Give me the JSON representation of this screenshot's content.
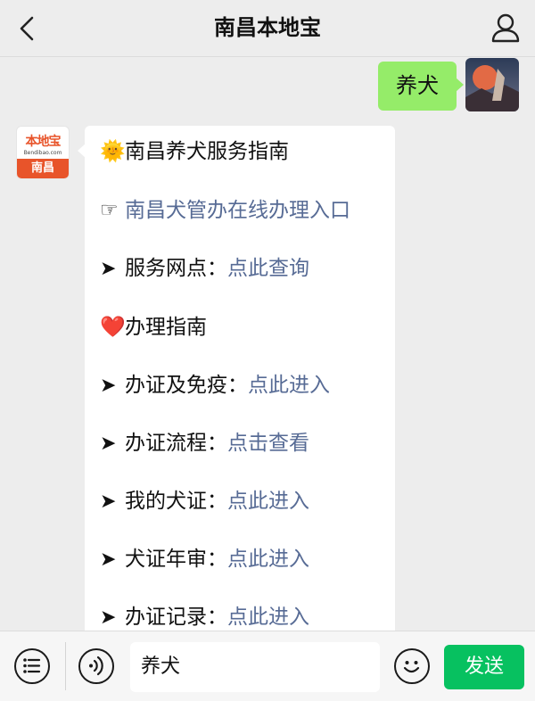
{
  "header": {
    "title": "南昌本地宝",
    "back_icon": "chevron-left-icon",
    "profile_icon": "person-icon"
  },
  "messages": {
    "sent": {
      "text": "养犬"
    },
    "bot": {
      "avatar": {
        "logo_text": "本地宝",
        "logo_url": "Bendibao.com",
        "city": "南昌"
      },
      "lines": [
        {
          "icon": "🌞",
          "text": "南昌养犬服务指南"
        },
        {
          "icon": "☞",
          "link": "南昌犬管办在线办理入口"
        },
        {
          "icon": "➤",
          "text": "服务网点：",
          "link": "点此查询"
        },
        {
          "icon": "❤️",
          "text": "办理指南"
        },
        {
          "icon": "➤",
          "text": "办证及免疫：",
          "link": "点此进入"
        },
        {
          "icon": "➤",
          "text": "办证流程：",
          "link": "点击查看"
        },
        {
          "icon": "➤",
          "text": "我的犬证：",
          "link": "点此进入"
        },
        {
          "icon": "➤",
          "text": "犬证年审：",
          "link": "点此进入"
        },
        {
          "icon": "➤",
          "text": "办证记录：",
          "link": "点此进入"
        }
      ]
    }
  },
  "input_bar": {
    "menu_icon": "menu-list-icon",
    "voice_icon": "voice-icon",
    "input_value": "养犬",
    "emoji_icon": "emoji-smile-icon",
    "send_label": "发送"
  },
  "colors": {
    "link": "#576b95",
    "my_bubble": "#95ec69",
    "send_button": "#07c160",
    "brand": "#e8542a"
  }
}
